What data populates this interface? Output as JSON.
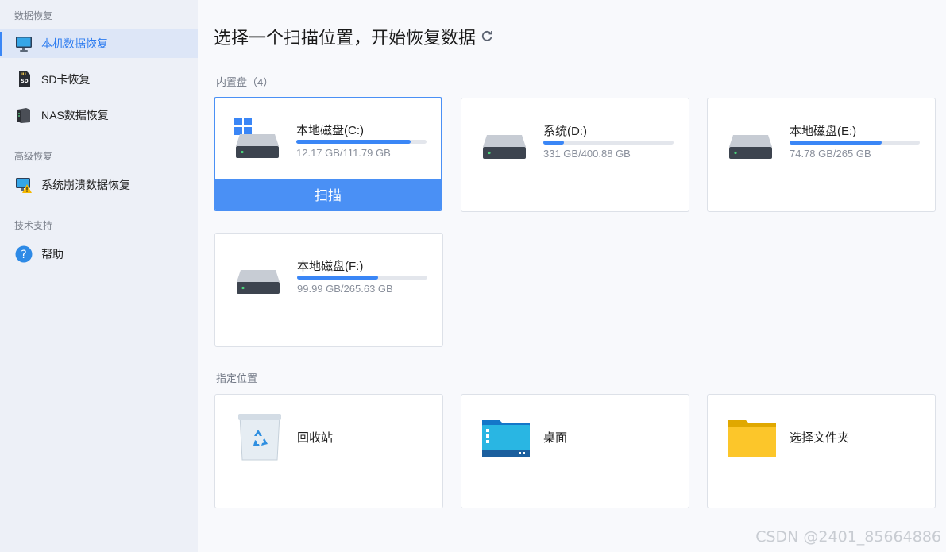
{
  "sidebar": {
    "section_data_recovery": "数据恢复",
    "section_advanced": "高级恢复",
    "section_support": "技术支持",
    "items": [
      {
        "label": "本机数据恢复",
        "icon": "monitor-icon",
        "active": true
      },
      {
        "label": "SD卡恢复",
        "icon": "sd-card-icon"
      },
      {
        "label": "NAS数据恢复",
        "icon": "nas-icon"
      },
      {
        "label": "系统崩溃数据恢复",
        "icon": "crashed-system-icon"
      },
      {
        "label": "帮助",
        "icon": "help-icon"
      }
    ]
  },
  "main": {
    "title": "选择一个扫描位置，开始恢复数据",
    "internal_label": "内置盘（4）",
    "location_label": "指定位置",
    "disks": [
      {
        "name": "本地磁盘(C:)",
        "size": "12.17 GB/111.79 GB",
        "usage": 0.88,
        "scan_label": "扫描",
        "selected": true
      },
      {
        "name": "系统(D:)",
        "size": "331 GB/400.88 GB",
        "usage": 0.16
      },
      {
        "name": "本地磁盘(E:)",
        "size": "74.78 GB/265 GB",
        "usage": 0.71
      },
      {
        "name": "本地磁盘(F:)",
        "size": "99.99 GB/265.63 GB",
        "usage": 0.62
      }
    ],
    "locations": [
      {
        "name": "回收站",
        "icon": "recycle-bin-icon"
      },
      {
        "name": "桌面",
        "icon": "desktop-icon"
      },
      {
        "name": "选择文件夹",
        "icon": "folder-icon"
      }
    ]
  },
  "colors": {
    "accent": "#3a86f6",
    "scan_button": "#4a90f5",
    "sidebar_bg": "#edf0f7"
  },
  "watermark": "CSDN @2401_85664886"
}
